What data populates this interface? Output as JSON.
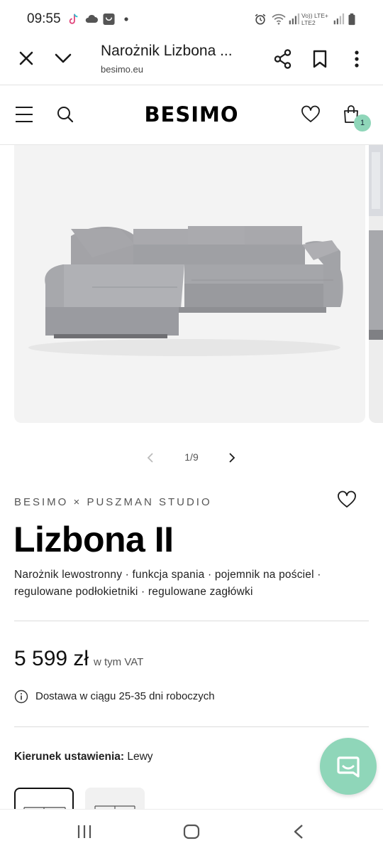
{
  "status_bar": {
    "time": "09:55",
    "right_text": "Vo)) LTE+ LTE2",
    "icons": [
      "tiktok-icon",
      "cloud-icon",
      "shopping-bag-icon",
      "dot-icon",
      "alarm-icon",
      "wifi-icon",
      "signal-icon",
      "battery-icon"
    ]
  },
  "browser": {
    "title": "Narożnik Lizbona ...",
    "url": "besimo.eu",
    "icons": [
      "close-icon",
      "chevron-down-icon",
      "share-icon",
      "bookmark-icon",
      "more-vert-icon"
    ]
  },
  "site_header": {
    "logo": "BESIMO",
    "cart_count": "1",
    "icons": [
      "menu-icon",
      "search-icon",
      "heart-icon",
      "cart-icon"
    ]
  },
  "gallery": {
    "counter": "1/9",
    "icons": [
      "chevron-left-icon",
      "chevron-right-icon"
    ]
  },
  "product": {
    "brand": "BESIMO × PUSZMAN STUDIO",
    "name": "Lizbona II",
    "description": "Narożnik lewostronny · funkcja spania · pojemnik na pościel · regulowane podłokietniki · regulowane zagłówki",
    "price": "5 599 zł",
    "vat_note": "w tym VAT",
    "delivery": "Dostawa w ciągu 25-35 dni roboczych",
    "orientation_label": "Kierunek ustawienia:",
    "orientation_value": "Lewy"
  },
  "colors": {
    "accent": "#8fd6b9",
    "divider": "#dcdcdc",
    "text": "#111111"
  }
}
